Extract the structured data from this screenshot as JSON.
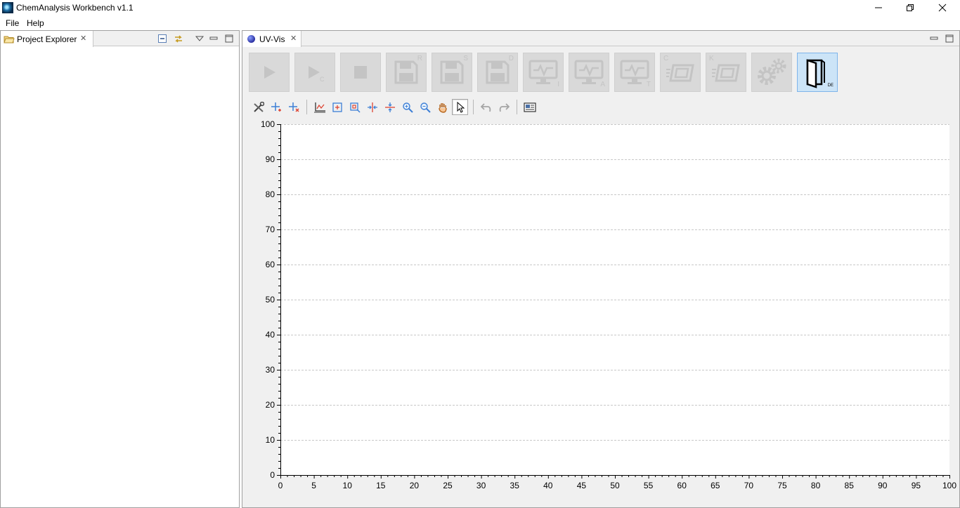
{
  "window": {
    "title": "ChemAnalysis Workbench v1.1",
    "icon": "app-icon",
    "controls": [
      "minimize-icon",
      "restore-icon",
      "close-icon"
    ]
  },
  "menu": {
    "items": [
      {
        "label": "File"
      },
      {
        "label": "Help"
      }
    ]
  },
  "left_panel": {
    "tab_label": "Project Explorer",
    "tab_icon": "folder-icon",
    "toolbar_icons": [
      "collapse-all-icon",
      "link-editor-icon",
      "view-menu-icon",
      "minimize-icon",
      "maximize-icon"
    ]
  },
  "right_panel": {
    "tab_label": "UV-Vis",
    "tab_icon": "globe-icon",
    "big_toolbar": [
      {
        "icon": "play-icon",
        "letter": ""
      },
      {
        "icon": "play-continue-icon",
        "letter": "C"
      },
      {
        "icon": "stop-icon",
        "letter": ""
      },
      {
        "icon": "save-icon",
        "letter": "R"
      },
      {
        "icon": "save-icon",
        "letter": "S"
      },
      {
        "icon": "save-icon",
        "letter": "D"
      },
      {
        "icon": "monitor-icon",
        "letter": "I"
      },
      {
        "icon": "monitor-icon",
        "letter": "A"
      },
      {
        "icon": "monitor-icon",
        "letter": "T"
      },
      {
        "icon": "device-icon",
        "letter": "C"
      },
      {
        "icon": "device-icon",
        "letter": "K"
      },
      {
        "icon": "settings-gears-icon",
        "letter": ""
      },
      {
        "icon": "door-exit-icon",
        "letter": "DE"
      }
    ],
    "small_toolbar": [
      "tools-icon",
      "add-marker-icon",
      "remove-marker-icon",
      "axis-settings-icon",
      "zoom-fit-icon",
      "zoom-box-icon",
      "split-vertical-icon",
      "split-horizontal-icon",
      "zoom-in-icon",
      "zoom-out-icon",
      "pan-hand-icon",
      "pointer-icon",
      "undo-icon",
      "redo-icon",
      "screenshot-icon"
    ]
  },
  "colors": {
    "panel_bg": "#f0f0f0",
    "button_disabled": "#d9d9d9",
    "button_active": "#cce4f7",
    "accent_blue": "#3c7fd6"
  },
  "chart_data": {
    "type": "line",
    "title": "",
    "xlabel": "",
    "ylabel": "",
    "xlim": [
      0,
      100
    ],
    "ylim": [
      0,
      100
    ],
    "x_ticks": [
      0,
      5,
      10,
      15,
      20,
      25,
      30,
      35,
      40,
      45,
      50,
      55,
      60,
      65,
      70,
      75,
      80,
      85,
      90,
      95,
      100
    ],
    "y_ticks": [
      0,
      10,
      20,
      30,
      40,
      50,
      60,
      70,
      80,
      90,
      100
    ],
    "grid": "horizontal dashed",
    "series": []
  }
}
